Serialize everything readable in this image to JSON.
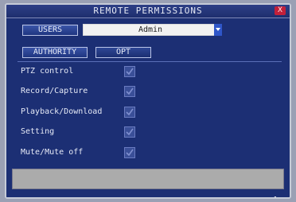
{
  "window": {
    "title": "REMOTE PERMISSIONS",
    "close_label": "X"
  },
  "user_row": {
    "users_button": "USERS",
    "selected_user": "Admin"
  },
  "tabs": {
    "authority_label": "AUTHORITY",
    "opt_label": "OPT"
  },
  "permissions": [
    {
      "label": "PTZ control",
      "checked": true
    },
    {
      "label": "Record/Capture",
      "checked": true
    },
    {
      "label": "Playback/Download",
      "checked": true
    },
    {
      "label": "Setting",
      "checked": true
    },
    {
      "label": "Mute/Mute off",
      "checked": true
    }
  ],
  "footer": {
    "ok_icon": "checkmark-icon"
  },
  "colors": {
    "dialog_background": "#1c2f74",
    "close_button": "#c2203a",
    "dropdown_arrow": "#2f56c8",
    "status_bar": "#ababab"
  }
}
